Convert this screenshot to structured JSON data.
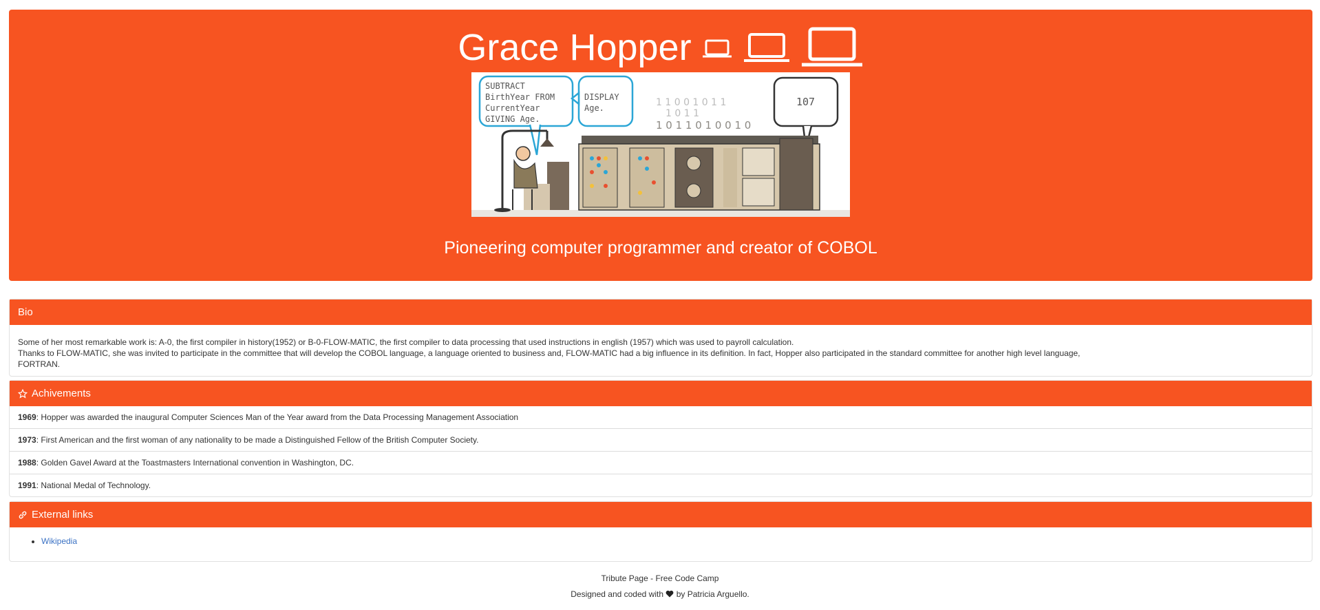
{
  "hero": {
    "title": "Grace Hopper",
    "tagline": "Pioneering computer programmer and creator of COBOL",
    "illustration": {
      "bubble_left": [
        "SUBTRACT",
        "BirthYear FROM",
        "CurrentYear",
        "GIVING Age."
      ],
      "bubble_mid": [
        "DISPLAY",
        "Age."
      ],
      "bubble_right": "107",
      "binary_rows": [
        "1 1 0 0 1 0 1  1",
        "1 0 1  1",
        "1 0 1 1 0 1 0 0 1 0"
      ]
    }
  },
  "bio": {
    "heading": "Bio",
    "lines": [
      "Some of her most remarkable work is: A-0, the first compiler in history(1952) or B-0-FLOW-MATIC, the first compiler to data processing that used instructions in english (1957) which was used to payroll calculation.",
      "Thanks to FLOW-MATIC, she was invited to participate in the committee that will develop the COBOL language, a language oriented to business and, FLOW-MATIC had a big influence in its definition. In fact, Hopper also participated in the standard committee for another high level language,",
      "FORTRAN."
    ]
  },
  "achievements": {
    "heading": "Achivements",
    "items": [
      {
        "year": "1969",
        "text": ": Hopper was awarded the inaugural Computer Sciences Man of the Year award from the Data Processing Management Association"
      },
      {
        "year": "1973",
        "text": ": First American and the first woman of any nationality to be made a Distinguished Fellow of the British Computer Society."
      },
      {
        "year": "1988",
        "text": ": Golden Gavel Award at the Toastmasters International convention in Washington, DC."
      },
      {
        "year": "1991",
        "text": ": National Medal of Technology."
      }
    ]
  },
  "links": {
    "heading": "External links",
    "items": [
      "Wikipedia"
    ]
  },
  "footer": {
    "line1": "Tribute Page - Free Code Camp",
    "line2_pre": "Designed and coded with",
    "line2_post": "by Patricia Arguello."
  },
  "colors": {
    "accent": "#f75421",
    "link": "#3b72c4"
  },
  "icons": [
    "laptop-icon",
    "star-icon",
    "link-icon",
    "heart-icon"
  ]
}
